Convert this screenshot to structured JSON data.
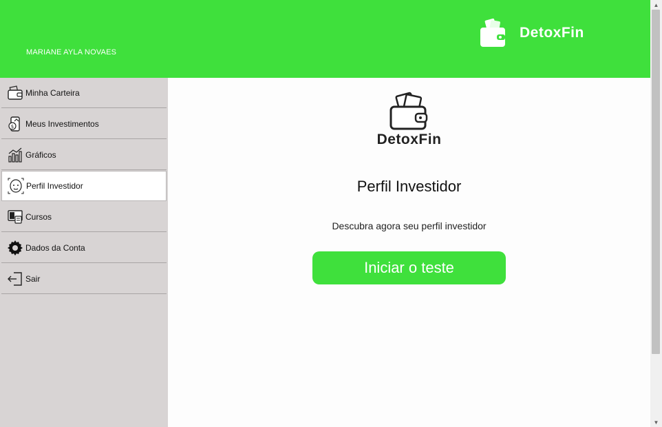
{
  "header": {
    "user_name": "MARIANE AYLA NOVAES",
    "brand": "DetoxFin",
    "accent_color": "#3fe03c"
  },
  "sidebar": {
    "items": [
      {
        "label": "Minha Carteira",
        "icon": "wallet-icon"
      },
      {
        "label": "Meus Investimentos",
        "icon": "investments-icon"
      },
      {
        "label": "Gráficos",
        "icon": "chart-icon"
      },
      {
        "label": "Perfil Investidor",
        "icon": "profile-face-icon",
        "active": true
      },
      {
        "label": "Cursos",
        "icon": "courses-icon"
      },
      {
        "label": "Dados da Conta",
        "icon": "gear-icon"
      },
      {
        "label": "Sair",
        "icon": "logout-icon"
      }
    ]
  },
  "main": {
    "brand": "DetoxFin",
    "title": "Perfil Investidor",
    "subtitle": "Descubra agora seu perfil investidor",
    "start_button": "Iniciar o teste"
  },
  "scrollbar": {
    "up_arrow": "▲",
    "down_arrow": "▼"
  }
}
